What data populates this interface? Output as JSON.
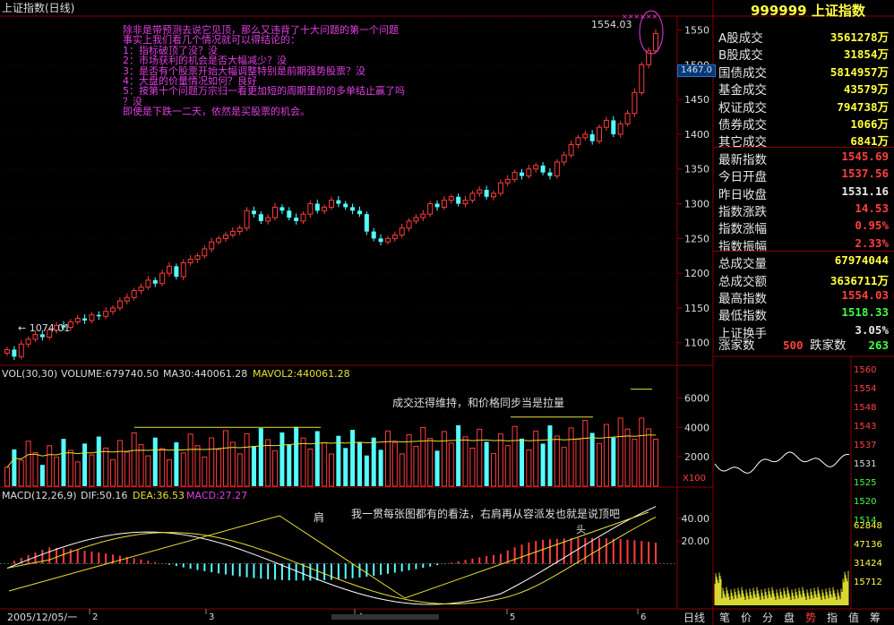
{
  "window_title": "上证指数(日线)",
  "colors": {
    "up": "#ff3c3c",
    "down": "#54ffff",
    "ma": "#e8e030",
    "annot": "#e040e0",
    "grid": "#8b0000",
    "value_yellow": "#ffff40",
    "value_red": "#ff4040",
    "value_green": "#40ff40"
  },
  "annotation": {
    "lines": [
      "除非是带预测去说它见顶，那么又违背了十大问题的第一个问题",
      "事实上我们看几个情况就可以得结论的：",
      "1：指标破顶了没？没",
      "2：市场获利的机会是否大幅减少？没",
      "3：是否有个股票开始大幅调整特别是前期强势股票？没",
      "4：大盘的价量情况如何？良好",
      "5：按第十个问题万宗归一看更加短的周期里前的多单结止赢了吗",
      "？没",
      "即使是下跌一二天，依然是买股票的机会。"
    ]
  },
  "price_panel": {
    "y_ticks": [
      "1550",
      "1500",
      "1450",
      "1400",
      "1350",
      "1300",
      "1250",
      "1200",
      "1150",
      "1100"
    ],
    "current_price_tag": "1467.0",
    "high_label": "1554.03",
    "low_label": "1074.01",
    "high_marker": "××××××"
  },
  "volume_panel": {
    "header": {
      "name": "VOL(30,30)",
      "volume": "VOLUME:679740.50",
      "ma30": "MA30:440061.28",
      "mavol2": "MAVOL2:440061.28"
    },
    "y_ticks": [
      "6000",
      "4000",
      "2000"
    ],
    "unit": "X100",
    "note": "成交还得维持，和价格同步当是拉量"
  },
  "macd_panel": {
    "header": {
      "name": "MACD(12,26,9)",
      "dif": "DIF:50.16",
      "dea": "DEA:36.53",
      "macd": "MACD:27.27"
    },
    "y_ticks": [
      "40.00",
      "20.00"
    ],
    "label_shoulder": "肩",
    "label_head": "头",
    "note": "我一贯每张图都有的看法，右肩再从容派发也就是说顶吧"
  },
  "date_axis": {
    "start": "2005/12/05/一",
    "marks": [
      "2",
      "3",
      "4",
      "5",
      "6"
    ]
  },
  "sidebar": {
    "title": "999999 上证指数",
    "rows": [
      {
        "label": "A股成交",
        "value": "3561278万",
        "color": "#ffff40"
      },
      {
        "label": "B股成交",
        "value": "31854万",
        "color": "#ffff40"
      },
      {
        "label": "国债成交",
        "value": "5814957万",
        "color": "#ffff40"
      },
      {
        "label": "基金成交",
        "value": "43579万",
        "color": "#ffff40"
      },
      {
        "label": "权证成交",
        "value": "794738万",
        "color": "#ffff40"
      },
      {
        "label": "债券成交",
        "value": "1066万",
        "color": "#ffff40"
      },
      {
        "label": "其它成交",
        "value": "6841万",
        "color": "#ffff40"
      },
      {
        "label": "最新指数",
        "value": "1545.69",
        "color": "#ff4040"
      },
      {
        "label": "今日开盘",
        "value": "1537.56",
        "color": "#ff4040"
      },
      {
        "label": "昨日收盘",
        "value": "1531.16",
        "color": "#e6e6e6"
      },
      {
        "label": "指数涨跌",
        "value": "14.53",
        "color": "#ff4040"
      },
      {
        "label": "指数涨幅",
        "value": "0.95%",
        "color": "#ff4040"
      },
      {
        "label": "指数振幅",
        "value": "2.33%",
        "color": "#ff4040"
      },
      {
        "label": "总成交量",
        "value": "67974044",
        "color": "#ffff40"
      },
      {
        "label": "总成交额",
        "value": "3636711万",
        "color": "#ffff40"
      },
      {
        "label": "最高指数",
        "value": "1554.03",
        "color": "#ff4040"
      },
      {
        "label": "最低指数",
        "value": "1518.33",
        "color": "#40ff40"
      },
      {
        "label": "上证换手",
        "value": "3.05%",
        "color": "#e6e6e6"
      }
    ],
    "breadth": {
      "up_label": "涨家数",
      "up_value": "500",
      "down_label": "跌家数",
      "down_value": "263"
    }
  },
  "intraday": {
    "price_ticks": [
      "1560",
      "1554",
      "1548",
      "1543",
      "1537",
      "1531",
      "1525",
      "1520",
      "1514"
    ],
    "vol_ticks": [
      "62848",
      "47136",
      "31424",
      "15712"
    ]
  },
  "bottom_tabs": [
    "日线",
    "笔",
    "价",
    "分",
    "盘",
    "势",
    "指",
    "值",
    "筹"
  ],
  "chart_data": {
    "type": "candlestick",
    "ylim": [
      1070,
      1570
    ],
    "first_date": "2005/12/05",
    "high": 1554.03,
    "low": 1074.01,
    "close_series": [
      1090,
      1080,
      1098,
      1105,
      1112,
      1108,
      1118,
      1125,
      1122,
      1130,
      1135,
      1132,
      1140,
      1138,
      1145,
      1150,
      1160,
      1165,
      1175,
      1180,
      1190,
      1185,
      1200,
      1210,
      1195,
      1215,
      1220,
      1225,
      1235,
      1245,
      1250,
      1255,
      1260,
      1265,
      1290,
      1285,
      1275,
      1280,
      1295,
      1290,
      1280,
      1275,
      1285,
      1300,
      1290,
      1295,
      1305,
      1300,
      1295,
      1290,
      1285,
      1260,
      1250,
      1245,
      1250,
      1255,
      1265,
      1275,
      1280,
      1285,
      1300,
      1295,
      1305,
      1310,
      1300,
      1305,
      1315,
      1320,
      1310,
      1315,
      1330,
      1335,
      1345,
      1340,
      1350,
      1355,
      1345,
      1340,
      1360,
      1370,
      1385,
      1395,
      1400,
      1390,
      1410,
      1420,
      1400,
      1415,
      1430,
      1460,
      1500,
      1520,
      1545
    ]
  }
}
